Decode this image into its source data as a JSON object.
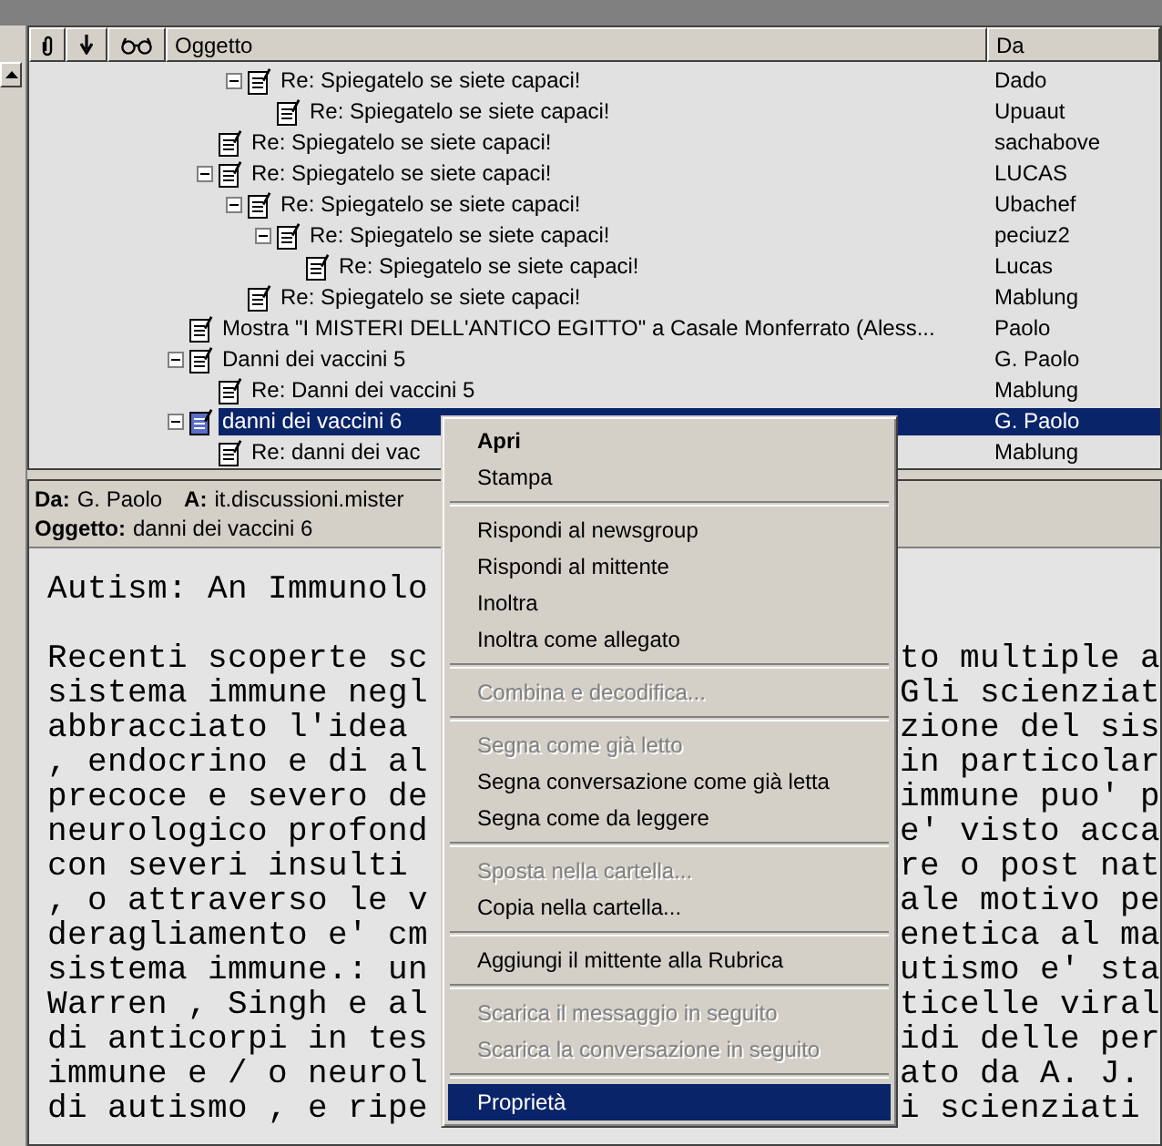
{
  "columns": [
    {
      "kind": "attachment"
    },
    {
      "kind": "priority"
    },
    {
      "kind": "watched"
    },
    {
      "kind": "text",
      "label": "Oggetto"
    },
    {
      "kind": "text",
      "label": "Da"
    }
  ],
  "threads": [
    {
      "children": [
        {
          "children": [
            {
              "subject": "Re: Spiegatelo se siete capaci!",
              "from": "Dado",
              "selected": false,
              "expanded": true,
              "children": [
                {
                  "subject": "Re: Spiegatelo se siete capaci!",
                  "from": "Upuaut",
                  "selected": false
                }
              ]
            }
          ]
        },
        {
          "subject": "Re: Spiegatelo se siete capaci!",
          "from": "sachabove",
          "selected": false
        },
        {
          "subject": "Re: Spiegatelo se siete capaci!",
          "from": "LUCAS",
          "selected": false,
          "expanded": true,
          "children": [
            {
              "subject": "Re: Spiegatelo se siete capaci!",
              "from": "Ubachef",
              "selected": false,
              "expanded": true,
              "children": [
                {
                  "subject": "Re: Spiegatelo se siete capaci!",
                  "from": "peciuz2",
                  "selected": false,
                  "expanded": true,
                  "children": [
                    {
                      "subject": "Re: Spiegatelo se siete capaci!",
                      "from": "Lucas",
                      "selected": false
                    }
                  ]
                }
              ]
            },
            {
              "subject": "Re: Spiegatelo se siete capaci!",
              "from": "Mablung",
              "selected": false
            }
          ]
        }
      ]
    },
    {
      "subject": "Mostra \"I MISTERI DELL'ANTICO EGITTO\" a Casale Monferrato (Aless...",
      "from": "Paolo",
      "selected": false
    },
    {
      "subject": "Danni dei vaccini 5",
      "from": "G. Paolo",
      "selected": false,
      "expanded": true,
      "children": [
        {
          "subject": "Re: Danni dei vaccini 5",
          "from": "Mablung",
          "selected": false
        }
      ]
    },
    {
      "subject": "danni dei vaccini 6",
      "from": "G. Paolo",
      "selected": true,
      "expanded": true,
      "children": [
        {
          "subject": "Re: danni dei vac",
          "from": "Mablung",
          "selected": false
        }
      ]
    }
  ],
  "preview": {
    "from_label": "Da:",
    "from": "G. Paolo",
    "to_label": "A:",
    "to": "it.discussioni.mister",
    "subject_label": "Oggetto:",
    "subject": "danni dei vaccini 6",
    "body_lines": [
      {
        "kind": "heading",
        "left": "Autism: An Immunolo"
      },
      {
        "left": "Recenti scoperte sc",
        "right": "to multiple a"
      },
      {
        "left": "sistema immune negl",
        "right": "Gli scienziat"
      },
      {
        "left": "abbracciato l'idea",
        "right": "zione del sis"
      },
      {
        "left": ", endocrino e di al",
        "right": "in particolar"
      },
      {
        "left": "precoce e severo de",
        "right": "immune puo' p"
      },
      {
        "left": "neurologico profond",
        "right": "e' visto acca"
      },
      {
        "left": "con severi insulti",
        "right": "re o post nat"
      },
      {
        "left": ", o attraverso le v",
        "right": "ale motivo pe"
      },
      {
        "left": "deragliamento e' cm",
        "right": "enetica al ma"
      },
      {
        "left": "sistema immune.: un",
        "right": "utismo e' sta"
      },
      {
        "left": "Warren , Singh e al",
        "right": "ticelle viral"
      },
      {
        "left": "di anticorpi in tes",
        "right": "idi delle per"
      },
      {
        "left": "immune e / o neurol",
        "right": "ato da A. J."
      },
      {
        "left": "di autismo , e ripe",
        "right": "i scienziati"
      }
    ]
  },
  "context_menu": [
    {
      "kind": "item",
      "label": "Apri",
      "default": true,
      "disabled": false,
      "selected": false
    },
    {
      "kind": "item",
      "label": "Stampa",
      "default": false,
      "disabled": false,
      "selected": false
    },
    {
      "kind": "separator"
    },
    {
      "kind": "item",
      "label": "Rispondi al newsgroup",
      "default": false,
      "disabled": false,
      "selected": false
    },
    {
      "kind": "item",
      "label": "Rispondi al mittente",
      "default": false,
      "disabled": false,
      "selected": false
    },
    {
      "kind": "item",
      "label": "Inoltra",
      "default": false,
      "disabled": false,
      "selected": false
    },
    {
      "kind": "item",
      "label": "Inoltra come allegato",
      "default": false,
      "disabled": false,
      "selected": false
    },
    {
      "kind": "separator"
    },
    {
      "kind": "item",
      "label": "Combina e decodifica...",
      "default": false,
      "disabled": true,
      "selected": false
    },
    {
      "kind": "separator"
    },
    {
      "kind": "item",
      "label": "Segna come già letto",
      "default": false,
      "disabled": true,
      "selected": false
    },
    {
      "kind": "item",
      "label": "Segna conversazione come già letta",
      "default": false,
      "disabled": false,
      "selected": false
    },
    {
      "kind": "item",
      "label": "Segna come da leggere",
      "default": false,
      "disabled": false,
      "selected": false
    },
    {
      "kind": "separator"
    },
    {
      "kind": "item",
      "label": "Sposta nella cartella...",
      "default": false,
      "disabled": true,
      "selected": false
    },
    {
      "kind": "item",
      "label": "Copia nella cartella...",
      "default": false,
      "disabled": false,
      "selected": false
    },
    {
      "kind": "separator"
    },
    {
      "kind": "item",
      "label": "Aggiungi il mittente alla Rubrica",
      "default": false,
      "disabled": false,
      "selected": false
    },
    {
      "kind": "separator"
    },
    {
      "kind": "item",
      "label": "Scarica il messaggio in seguito",
      "default": false,
      "disabled": true,
      "selected": false
    },
    {
      "kind": "item",
      "label": "Scarica la conversazione in seguito",
      "default": false,
      "disabled": true,
      "selected": false
    },
    {
      "kind": "separator"
    },
    {
      "kind": "item",
      "label": "Proprietà",
      "default": false,
      "disabled": false,
      "selected": true
    }
  ]
}
